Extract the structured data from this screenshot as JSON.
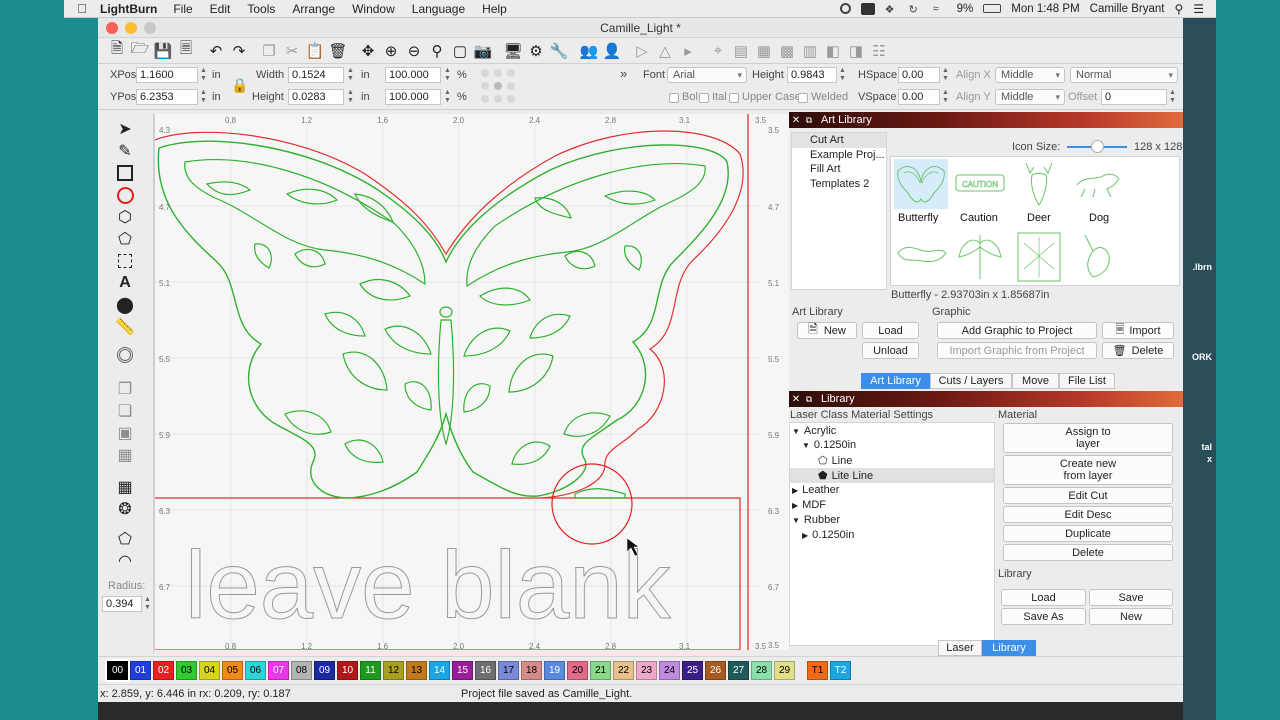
{
  "menubar": {
    "app_name": "LightBurn",
    "items": [
      "File",
      "Edit",
      "Tools",
      "Arrange",
      "Window",
      "Language",
      "Help"
    ],
    "battery": "9%",
    "clock": "Mon 1:48 PM",
    "user": "Camille Bryant"
  },
  "desktop": {
    "file_label": ".lbrn",
    "label_ork": "ORK",
    "label_tal": "tal",
    "label_x": "x"
  },
  "window": {
    "title": "Camille_Light *"
  },
  "props": {
    "xpos_label": "XPos",
    "xpos": "1.1600",
    "ypos_label": "YPos",
    "ypos": "6.2353",
    "unit_in": "in",
    "width_label": "Width",
    "width": "0.1524",
    "height_label": "Height",
    "height": "0.0283",
    "scale_w": "100.000",
    "scale_h": "100.000",
    "pct": "%",
    "font_label": "Font",
    "font": "Arial",
    "text_height_label": "Height",
    "text_height": "0.9843",
    "hspace_label": "HSpace",
    "hspace": "0.00",
    "vspace_label": "VSpace",
    "vspace": "0.00",
    "alignx_label": "Align X",
    "alignx": "Middle",
    "aligny_label": "Align Y",
    "aligny": "Middle",
    "mode": "Normal",
    "offset_label": "Offset",
    "offset": "0",
    "bold": "Bol",
    "italic": "Ital",
    "upper": "Upper Case",
    "welded": "Welded",
    "chevrons": "»"
  },
  "tools": {
    "radius_label": "Radius:",
    "radius": "0.394"
  },
  "canvas": {
    "ruler_top": [
      "0.8",
      "1.2",
      "1.6",
      "2.0",
      "2.4",
      "2.8",
      "3.1",
      "3.5"
    ],
    "ruler_left": [
      "4.3",
      "4.7",
      "5.1",
      "5.5",
      "5.9",
      "6.3",
      "6.7"
    ],
    "ruler_right": [
      "3.5",
      "4.7",
      "5.1",
      "5.5",
      "5.9",
      "6.3",
      "6.7",
      "3.5"
    ],
    "leave_blank": "leave blank"
  },
  "art_library": {
    "panel_title": "Art Library",
    "library_list": [
      "Cut Art",
      "Example Proj...",
      "Fill Art",
      "Templates 2"
    ],
    "icon_size_label": "Icon Size:",
    "icon_size_value": "128 x 128",
    "thumbs": [
      "Butterfly",
      "Caution",
      "Deer",
      "Dog"
    ],
    "caution_word": "CAUTION",
    "selected_info": "Butterfly - 2.93703in x 1.85687in",
    "section_library": "Art Library",
    "section_graphic": "Graphic",
    "btn_new": "New",
    "btn_load": "Load",
    "btn_unload": "Unload",
    "btn_add_graphic": "Add Graphic to Project",
    "btn_import_graphic": "Import Graphic from Project",
    "btn_import": "Import",
    "btn_delete": "Delete"
  },
  "tabs_top": [
    "Art Library",
    "Cuts / Layers",
    "Move",
    "File List"
  ],
  "material_library": {
    "panel_title": "Library",
    "settings_header": "Laser Class Material Settings",
    "material_header": "Material",
    "tree": {
      "acrylic": "Acrylic",
      "acrylic_thick": "0.1250in",
      "line": "Line",
      "lite_line": "Lite Line",
      "leather": "Leather",
      "mdf": "MDF",
      "rubber": "Rubber",
      "rubber_thick": "0.1250in"
    },
    "btn_assign_1": "Assign to",
    "btn_assign_2": "layer",
    "btn_create_1": "Create new",
    "btn_create_2": "from layer",
    "btn_edit_cut": "Edit Cut",
    "btn_edit_desc": "Edit Desc",
    "btn_duplicate": "Duplicate",
    "btn_delete": "Delete",
    "library_section": "Library",
    "btn_load": "Load",
    "btn_save": "Save",
    "btn_save_as": "Save As",
    "btn_new": "New"
  },
  "tabs_bottom": [
    "Laser",
    "Library"
  ],
  "palette": [
    {
      "l": "00",
      "c": "#000000",
      "t": "#ffffff"
    },
    {
      "l": "01",
      "c": "#1f3fd8",
      "t": "#ffffff"
    },
    {
      "l": "02",
      "c": "#e82020",
      "t": "#ffffff"
    },
    {
      "l": "03",
      "c": "#2ecc2e",
      "t": "#000000"
    },
    {
      "l": "04",
      "c": "#d6d41e",
      "t": "#000000"
    },
    {
      "l": "05",
      "c": "#f08a18",
      "t": "#000000"
    },
    {
      "l": "06",
      "c": "#2ad6d6",
      "t": "#000000"
    },
    {
      "l": "07",
      "c": "#e838e8",
      "t": "#ffffff"
    },
    {
      "l": "08",
      "c": "#b4b4b4",
      "t": "#000000"
    },
    {
      "l": "09",
      "c": "#1a2aa0",
      "t": "#ffffff"
    },
    {
      "l": "10",
      "c": "#b01818",
      "t": "#ffffff"
    },
    {
      "l": "11",
      "c": "#1e9a1e",
      "t": "#ffffff"
    },
    {
      "l": "12",
      "c": "#a8a01e",
      "t": "#000000"
    },
    {
      "l": "13",
      "c": "#c07a18",
      "t": "#000000"
    },
    {
      "l": "14",
      "c": "#1aa6e0",
      "t": "#ffffff"
    },
    {
      "l": "15",
      "c": "#9a1e9a",
      "t": "#ffffff"
    },
    {
      "l": "16",
      "c": "#6e6e6e",
      "t": "#ffffff"
    },
    {
      "l": "17",
      "c": "#7a8ad8",
      "t": "#000000"
    },
    {
      "l": "18",
      "c": "#d88a8a",
      "t": "#000000"
    },
    {
      "l": "19",
      "c": "#5a8ae0",
      "t": "#ffffff"
    },
    {
      "l": "20",
      "c": "#e06a8a",
      "t": "#000000"
    },
    {
      "l": "21",
      "c": "#8ad88a",
      "t": "#000000"
    },
    {
      "l": "22",
      "c": "#e8c08a",
      "t": "#000000"
    },
    {
      "l": "23",
      "c": "#f0a8c8",
      "t": "#000000"
    },
    {
      "l": "24",
      "c": "#c08ae0",
      "t": "#000000"
    },
    {
      "l": "25",
      "c": "#3a1e8a",
      "t": "#ffffff"
    },
    {
      "l": "26",
      "c": "#a85a1e",
      "t": "#ffffff"
    },
    {
      "l": "27",
      "c": "#1e5a5a",
      "t": "#ffffff"
    },
    {
      "l": "28",
      "c": "#8ae0a8",
      "t": "#000000"
    },
    {
      "l": "29",
      "c": "#e0e08a",
      "t": "#000000"
    },
    {
      "l": "T1",
      "c": "#f06a18",
      "t": "#000000"
    },
    {
      "l": "T2",
      "c": "#1aa6e0",
      "t": "#ffffff"
    }
  ],
  "status": {
    "coords": "x: 2.859, y: 6.446 in  rx: 0.209,  ry: 0.187",
    "message": "Project file saved as Camille_Light."
  }
}
